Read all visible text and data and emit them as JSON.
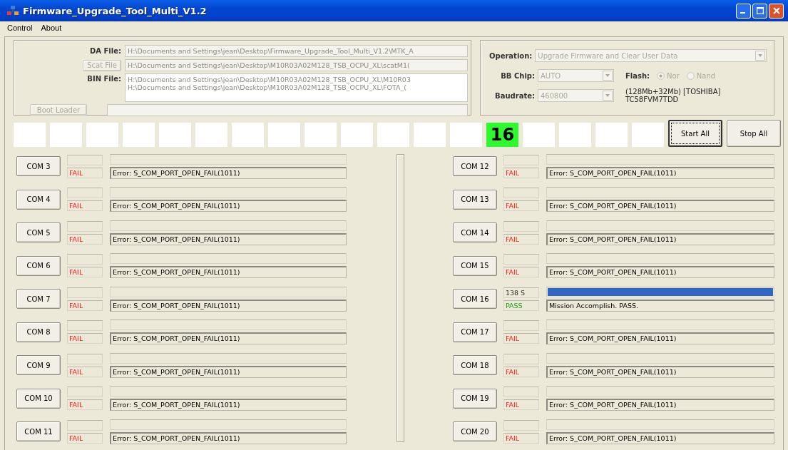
{
  "window": {
    "title": "Firmware_Upgrade_Tool_Multi_V1.2"
  },
  "menu": [
    "Control",
    "About"
  ],
  "files": {
    "da_label": "DA File:",
    "da_value": "H:\\Documents and Settings\\jean\\Desktop\\Firmware_Upgrade_Tool_Multi_V1.2\\MTK_A",
    "scat_button": "Scat File",
    "scat_value": "H:\\Documents and Settings\\jean\\Desktop\\M10R03A02M128_TSB_OCPU_XL\\scatM1(",
    "bin_label": "BIN File:",
    "bin_lines": [
      "H:\\Documents and Settings\\jean\\Desktop\\M10R03A02M128_TSB_OCPU_XL\\M10R03",
      "H:\\Documents and Settings\\jean\\Desktop\\M10R03A02M128_TSB_OCPU_XL\\FOTA_("
    ],
    "boot_button": "Boot Loader"
  },
  "settings": {
    "operation_label": "Operation:",
    "operation_value": "Upgrade Firmware and Clear User Data",
    "bb_label": "BB Chip:",
    "bb_value": "AUTO",
    "baud_label": "Baudrate:",
    "baud_value": "460800",
    "flash_label": "Flash:",
    "flash_options": [
      {
        "label": "Nor",
        "selected": true
      },
      {
        "label": "Nand",
        "selected": false
      }
    ],
    "flash_info": [
      "(128Mb+32Mb) [TOSHIBA]",
      "TC58FVM7TDD"
    ]
  },
  "slots": [
    {
      "kind": "empty"
    },
    {
      "kind": "empty"
    },
    {
      "kind": "empty"
    },
    {
      "kind": "empty"
    },
    {
      "kind": "empty"
    },
    {
      "kind": "empty"
    },
    {
      "kind": "empty"
    },
    {
      "kind": "empty"
    },
    {
      "kind": "empty"
    },
    {
      "kind": "empty"
    },
    {
      "kind": "empty"
    },
    {
      "kind": "empty"
    },
    {
      "kind": "empty"
    },
    {
      "kind": "pass",
      "label": "16"
    },
    {
      "kind": "empty"
    },
    {
      "kind": "empty"
    },
    {
      "kind": "empty"
    },
    {
      "kind": "empty"
    }
  ],
  "buttons": [
    "Start All",
    "Stop All"
  ],
  "ports_left": [
    {
      "port": "COM 3",
      "status": "FAIL",
      "kind": "fail",
      "level": 0,
      "message": "Error: S_COM_PORT_OPEN_FAIL(1011)"
    },
    {
      "port": "COM 4",
      "status": "FAIL",
      "kind": "fail",
      "level": 0,
      "message": "Error: S_COM_PORT_OPEN_FAIL(1011)"
    },
    {
      "port": "COM 5",
      "status": "FAIL",
      "kind": "fail",
      "level": 0,
      "message": "Error: S_COM_PORT_OPEN_FAIL(1011)"
    },
    {
      "port": "COM 6",
      "status": "FAIL",
      "kind": "fail",
      "level": 0,
      "message": "Error: S_COM_PORT_OPEN_FAIL(1011)"
    },
    {
      "port": "COM 7",
      "status": "FAIL",
      "kind": "fail",
      "level": 0,
      "message": "Error: S_COM_PORT_OPEN_FAIL(1011)"
    },
    {
      "port": "COM 8",
      "status": "FAIL",
      "kind": "fail",
      "level": 0,
      "message": "Error: S_COM_PORT_OPEN_FAIL(1011)"
    },
    {
      "port": "COM 9",
      "status": "FAIL",
      "kind": "fail",
      "level": 0,
      "message": "Error: S_COM_PORT_OPEN_FAIL(1011)"
    },
    {
      "port": "COM 10",
      "status": "FAIL",
      "kind": "fail",
      "level": 0,
      "message": "Error: S_COM_PORT_OPEN_FAIL(1011)"
    },
    {
      "port": "COM 11",
      "status": "FAIL",
      "kind": "fail",
      "level": 0,
      "message": "Error: S_COM_PORT_OPEN_FAIL(1011)"
    }
  ],
  "ports_right": [
    {
      "port": "COM 12",
      "status": "FAIL",
      "kind": "fail",
      "level": 0,
      "message": "Error: S_COM_PORT_OPEN_FAIL(1011)"
    },
    {
      "port": "COM 13",
      "status": "FAIL",
      "kind": "fail",
      "level": 0,
      "message": "Error: S_COM_PORT_OPEN_FAIL(1011)"
    },
    {
      "port": "COM 14",
      "status": "FAIL",
      "kind": "fail",
      "level": 0,
      "message": "Error: S_COM_PORT_OPEN_FAIL(1011)"
    },
    {
      "port": "COM 15",
      "status": "FAIL",
      "kind": "fail",
      "level": 0,
      "message": "Error: S_COM_PORT_OPEN_FAIL(1011)"
    },
    {
      "port": "COM 16",
      "time": "138 S",
      "status": "PASS",
      "kind": "pass",
      "level": 1,
      "message": "Mission Accomplish. PASS."
    },
    {
      "port": "COM 17",
      "status": "FAIL",
      "kind": "fail",
      "level": 0,
      "message": "Error: S_COM_PORT_OPEN_FAIL(1011)"
    },
    {
      "port": "COM 18",
      "status": "FAIL",
      "kind": "fail",
      "level": 0,
      "message": "Error: S_COM_PORT_OPEN_FAIL(1011)"
    },
    {
      "port": "COM 19",
      "status": "FAIL",
      "kind": "fail",
      "level": 0,
      "message": "Error: S_COM_PORT_OPEN_FAIL(1011)"
    },
    {
      "port": "COM 20",
      "status": "FAIL",
      "kind": "fail",
      "level": 0,
      "message": "Error: S_COM_PORT_OPEN_FAIL(1011)"
    }
  ]
}
